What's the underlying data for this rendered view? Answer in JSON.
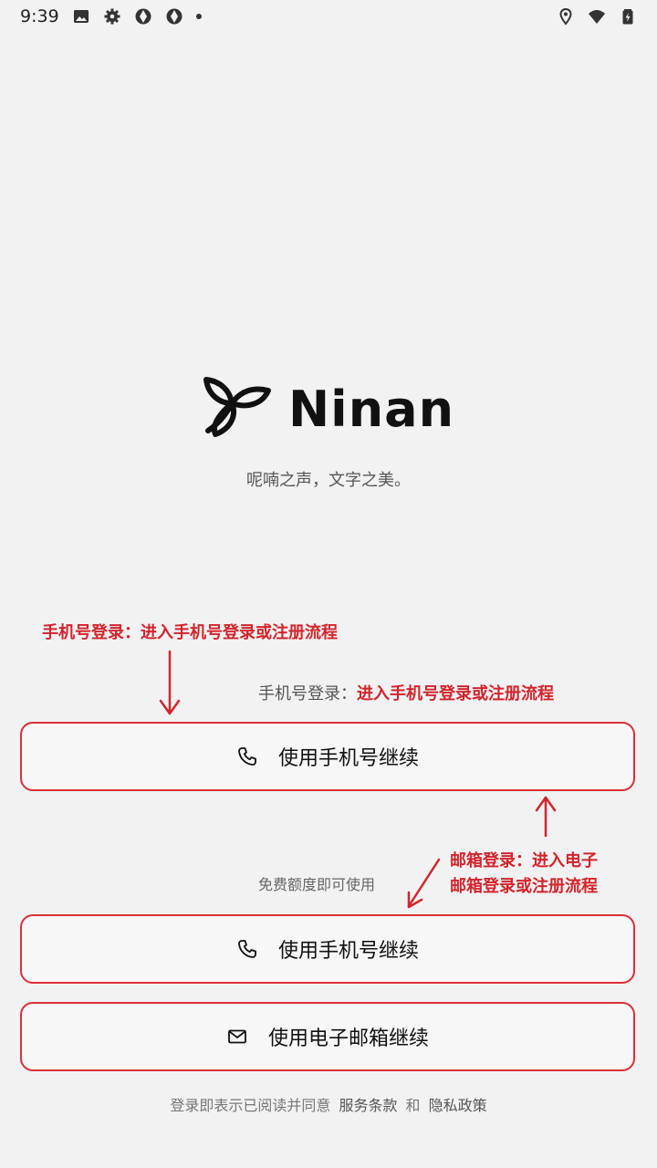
{
  "status_bar": {
    "time": "9:39",
    "left_icons": [
      "image-icon",
      "settings-icon",
      "aperture-icon",
      "aperture-icon"
    ],
    "right_icons": [
      "location-icon",
      "wifi-icon",
      "battery-charging-icon"
    ]
  },
  "brand": {
    "name": "Ninan",
    "tagline": "呢喃之声，文字之美。"
  },
  "annotations": {
    "phone_top": "手机号登录：进入手机号登录或注册流程",
    "phone_mid_prefix": "手机号登录：",
    "phone_mid_desc": "进入手机号登录或注册流程",
    "email_line1": "邮箱登录：进入电子",
    "email_line2": "邮箱登录或注册流程",
    "annotation_color": "#d3242c"
  },
  "buttons": {
    "phone_primary": "使用手机号继续",
    "phone_secondary": "使用手机号继续",
    "email": "使用电子邮箱继续"
  },
  "hint": "免费额度即可使用",
  "footer": {
    "prefix": "登录即表示已阅读并同意",
    "terms": "服务条款",
    "and": "和",
    "privacy": "隐私政策"
  }
}
